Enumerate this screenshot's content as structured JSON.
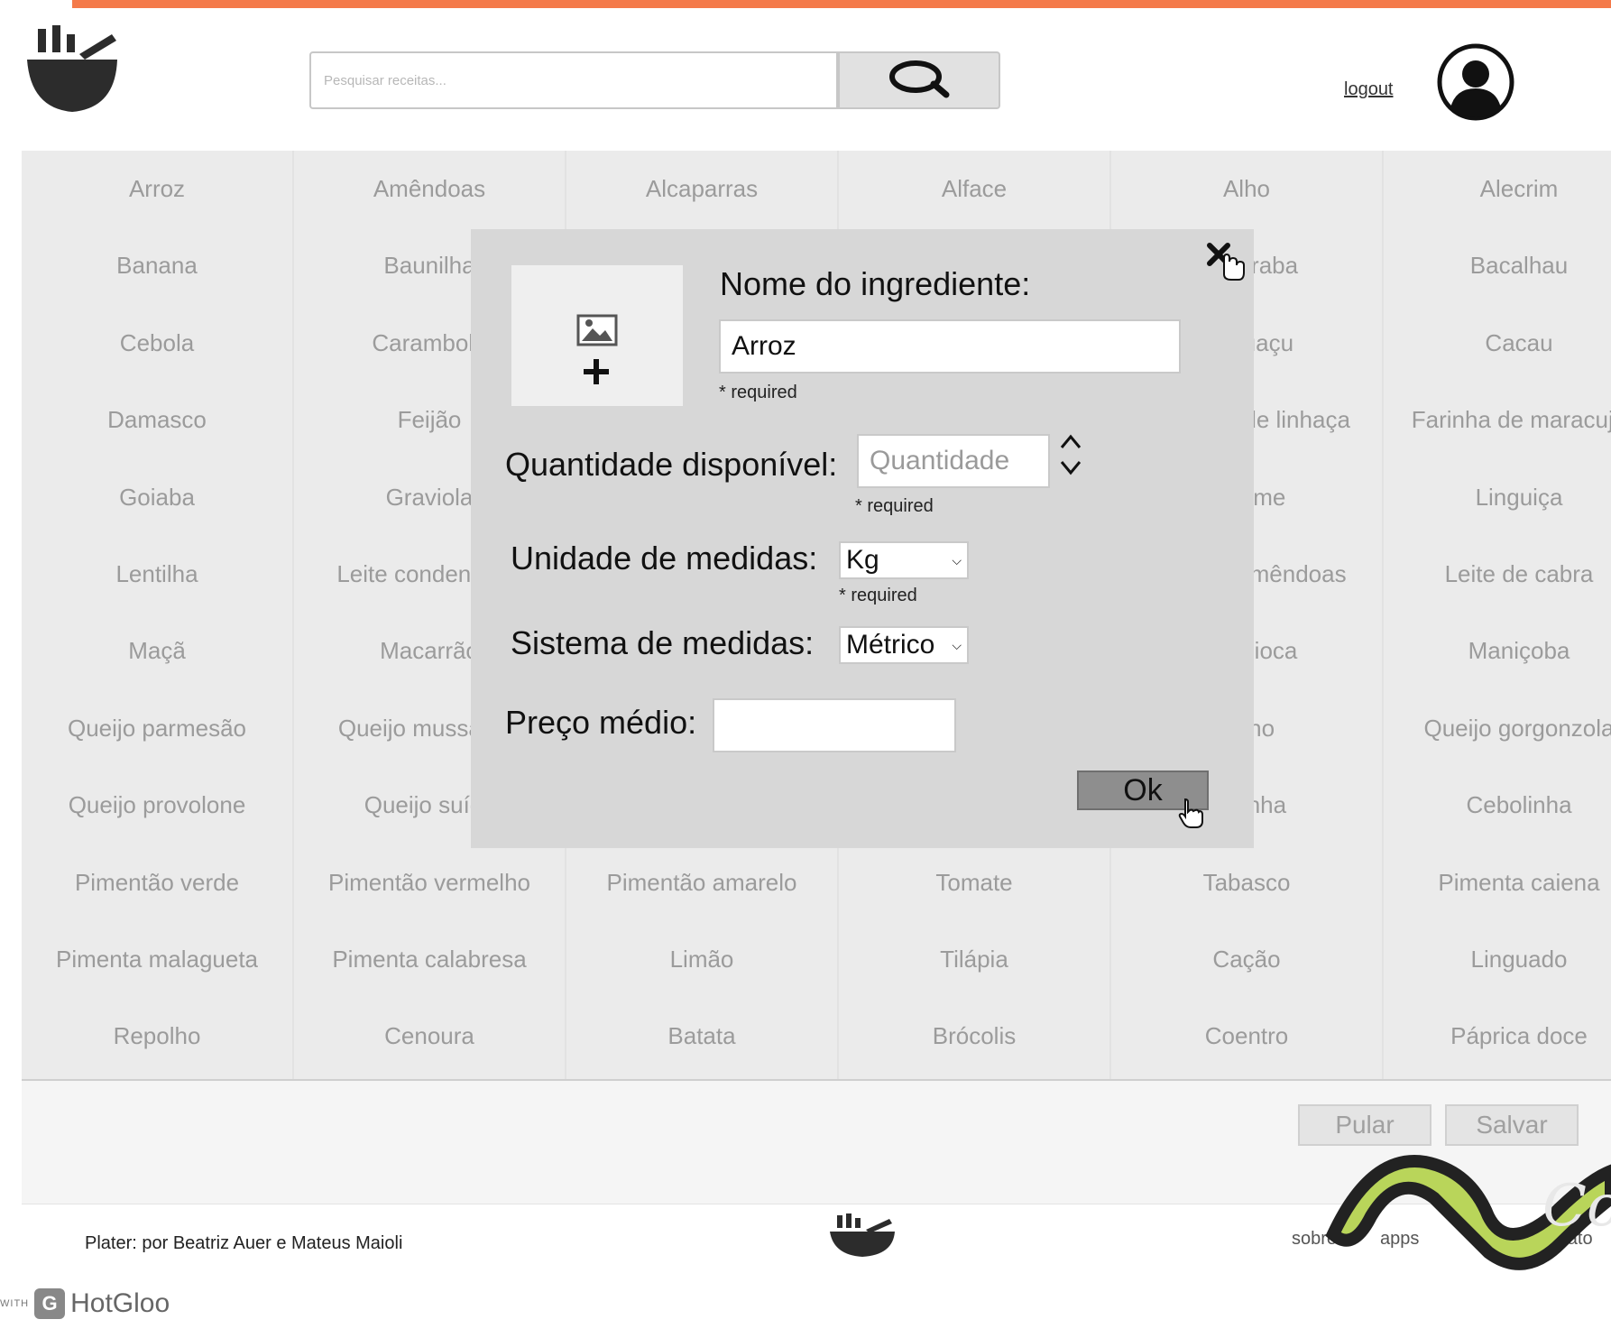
{
  "header": {
    "search_placeholder": "Pesquisar receitas...",
    "logout_label": "logout"
  },
  "ingredients": [
    [
      "Arroz",
      "Amêndoas",
      "Alcaparras",
      "Alface",
      "Alho",
      "Alecrim"
    ],
    [
      "Banana",
      "Baunilha",
      "",
      "",
      "Beterraba",
      "Bacalhau"
    ],
    [
      "Cebola",
      "Carambola",
      "",
      "",
      "Cupuaçu",
      "Cacau"
    ],
    [
      "Damasco",
      "Feijão",
      "",
      "",
      "Semente de linhaça",
      "Farinha de maracujá"
    ],
    [
      "Goiaba",
      "Graviola",
      "",
      "",
      "Inhame",
      "Linguiça"
    ],
    [
      "Lentilha",
      "Leite condensado",
      "",
      "",
      "Leite de amêndoas",
      "Leite de cabra"
    ],
    [
      "Maçã",
      "Macarrão",
      "",
      "",
      "Mandioca",
      "Maniçoba"
    ],
    [
      "Queijo parmesão",
      "Queijo mussarela",
      "",
      "",
      "Milho",
      "Queijo gorgonzola"
    ],
    [
      "Queijo provolone",
      "Queijo suíço",
      "",
      "",
      "Farinha",
      "Cebolinha"
    ],
    [
      "Pimentão verde",
      "Pimentão vermelho",
      "Pimentão amarelo",
      "Tomate",
      "Tabasco",
      "Pimenta caiena"
    ],
    [
      "Pimenta malagueta",
      "Pimenta calabresa",
      "Limão",
      "Tilápia",
      "Cação",
      "Linguado"
    ],
    [
      "Repolho",
      "Cenoura",
      "Batata",
      "Brócolis",
      "Coentro",
      "Páprica doce"
    ]
  ],
  "modal": {
    "name_label": "Nome do ingrediente:",
    "name_value": "Arroz",
    "required_text": "* required",
    "qty_label": "Quantidade disponível:",
    "qty_placeholder": "Quantidade",
    "unit_label": "Unidade de medidas:",
    "unit_value": "Kg",
    "system_label": "Sistema de medidas:",
    "system_value": "Métrico",
    "price_label": "Preço médio:",
    "price_value": "",
    "ok_label": "Ok"
  },
  "actions": {
    "skip_label": "Pular",
    "save_label": "Salvar"
  },
  "footer": {
    "credits": "Plater: por Beatriz Auer e Mateus Maioli",
    "link_about": "sobre",
    "link_apps": "apps",
    "link_contact": "contato"
  },
  "hotgloo": {
    "made_with": "WITH",
    "brand": "HotGloo"
  },
  "colors": {
    "accent_bar": "#f47a4a",
    "grid_background": "#ebebeb",
    "modal_background": "#d7d7d7",
    "ok_button": "#8e8e8e"
  },
  "icons": [
    "bowl-logo-icon",
    "search-icon",
    "user-avatar-icon",
    "image-placeholder-icon",
    "plus-icon",
    "close-icon",
    "chevron-up-icon",
    "chevron-down-icon",
    "hand-cursor-icon"
  ]
}
